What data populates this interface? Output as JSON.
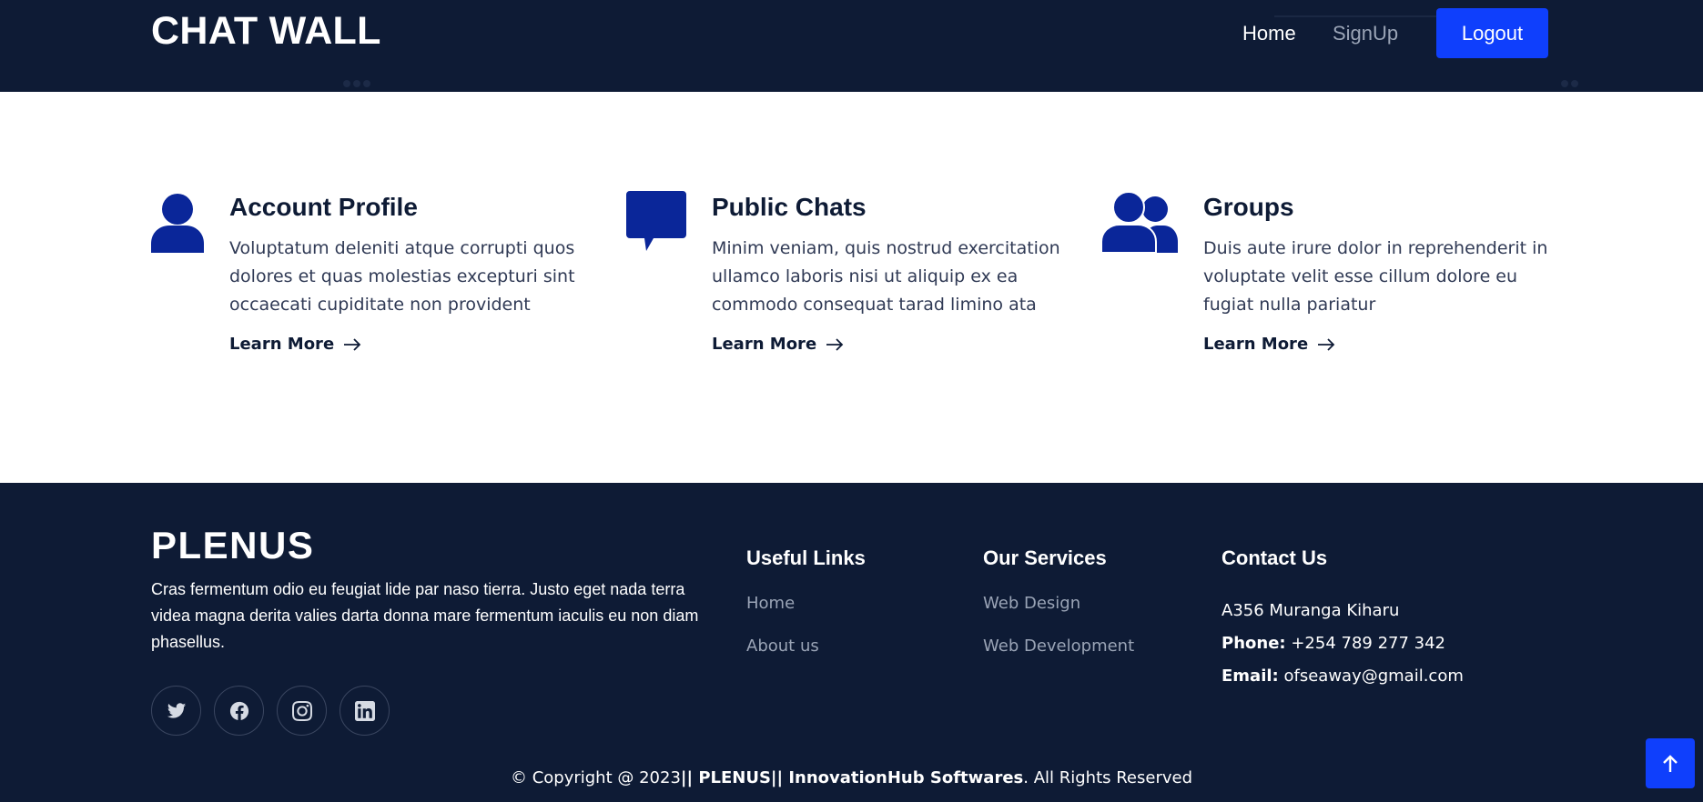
{
  "header": {
    "brand": "CHAT WALL",
    "nav": {
      "home": "Home",
      "signup": "SignUp",
      "logout": "Logout"
    }
  },
  "features": [
    {
      "icon": "user-icon",
      "title": "Account Profile",
      "description": "Voluptatum deleniti atque corrupti quos dolores et quas molestias excepturi sint occaecati cupiditate non provident",
      "link": "Learn More"
    },
    {
      "icon": "chat-bubble-icon",
      "title": "Public Chats",
      "description": "Minim veniam, quis nostrud exercitation ullamco laboris nisi ut aliquip ex ea commodo consequat tarad limino ata",
      "link": "Learn More"
    },
    {
      "icon": "users-group-icon",
      "title": "Groups",
      "description": "Duis aute irure dolor in reprehenderit in voluptate velit esse cillum dolore eu fugiat nulla pariatur",
      "link": "Learn More"
    }
  ],
  "footer": {
    "brand": "PLENUS",
    "description": "Cras fermentum odio eu feugiat lide par naso tierra. Justo eget nada terra videa magna derita valies darta donna mare fermentum iaculis eu non diam phasellus.",
    "socials": [
      "twitter-icon",
      "facebook-icon",
      "instagram-icon",
      "linkedin-icon"
    ],
    "useful_links": {
      "title": "Useful Links",
      "items": [
        "Home",
        "About us"
      ]
    },
    "services": {
      "title": "Our Services",
      "items": [
        "Web Design",
        "Web Development"
      ]
    },
    "contact": {
      "title": "Contact Us",
      "address": "A356 Muranga Kiharu",
      "phone_label": "Phone:",
      "phone": "+254 789 277 342",
      "email_label": "Email:",
      "email": "ofseaway@gmail.com"
    },
    "copyright": {
      "prefix": "© Copyright @ 2023",
      "company": "|| PLENUS|| InnovationHub Softwares",
      "suffix": ". All Rights Reserved"
    }
  },
  "colors": {
    "navy": "#0e1b35",
    "accent_blue": "#0f3ffc",
    "icon_blue": "#0a2699"
  }
}
